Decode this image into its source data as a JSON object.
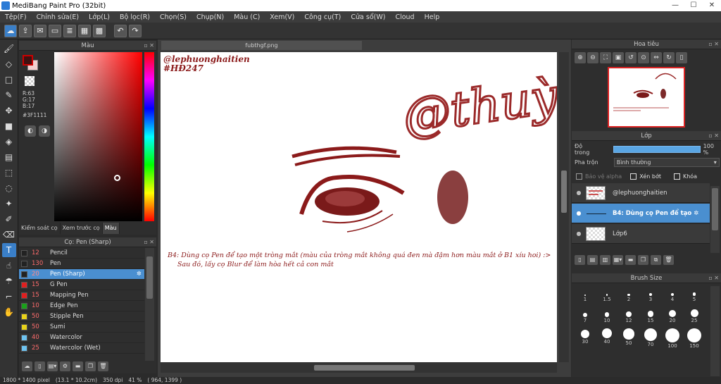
{
  "window": {
    "title": "MediBang Paint Pro (32bit)",
    "min": "—",
    "max": "☐",
    "close": "✕"
  },
  "menu": [
    "Tệp(F)",
    "Chỉnh sửa(E)",
    "Lớp(L)",
    "Bộ lọc(R)",
    "Chọn(S)",
    "Chụp(N)",
    "Màu (C)",
    "Xem(V)",
    "Công cụ(T)",
    "Cửa sổ(W)",
    "Cloud",
    "Help"
  ],
  "color_panel": {
    "title": "Màu",
    "r": "R:63",
    "g": "G:17",
    "b": "B:17",
    "hex": "#3F1111",
    "tabs": [
      "Kiểm soát cọ",
      "Xem trước cọ",
      "Màu"
    ],
    "fg_color": "#3f1111"
  },
  "brush_panel": {
    "title": "Cọ: Pen (Sharp)",
    "items": [
      {
        "size": "12",
        "name": "Pencil",
        "color": "#222222"
      },
      {
        "size": "130",
        "name": "Pen",
        "color": "#222222"
      },
      {
        "size": "20",
        "name": "Pen (Sharp)",
        "color": "#222222",
        "selected": true
      },
      {
        "size": "15",
        "name": "G Pen",
        "color": "#e02020"
      },
      {
        "size": "15",
        "name": "Mapping Pen",
        "color": "#e02020"
      },
      {
        "size": "10",
        "name": "Edge Pen",
        "color": "#1aa01a"
      },
      {
        "size": "50",
        "name": "Stipple Pen",
        "color": "#e8d21a"
      },
      {
        "size": "50",
        "name": "Sumi",
        "color": "#e8d21a"
      },
      {
        "size": "40",
        "name": "Watercolor",
        "color": "#6ec3f0"
      },
      {
        "size": "25",
        "name": "Watercolor (Wet)",
        "color": "#6ec3f0"
      }
    ]
  },
  "document": {
    "tab": "fubthgf.png",
    "credit": "@lephuonghaitien",
    "tag": "#HĐ247",
    "signature": "@thuỳ",
    "note_line1": "B4: Dùng cọ Pen để tạo một tròng mắt (màu của tròng mắt không quá đen mà đậm hơn màu mắt ở B1 xíu hoi) :>",
    "note_line2": "Sau đó, lấy cọ Blur để làm hòa hết cả con mắt"
  },
  "status": {
    "size": "1800 * 1400 pixel",
    "cm": "(13.1 * 10.2cm)",
    "dpi": "350 dpi",
    "zoom": "41 %",
    "coords": "( 964, 1399 )"
  },
  "navigator": {
    "title": "Hoa tiêu"
  },
  "layers_panel": {
    "title": "Lớp",
    "opacity_label": "Độ trong",
    "opacity_value": "100 %",
    "opacity": 1.0,
    "blend_label": "Pha trộn",
    "blend_value": "Bình thường",
    "protect_alpha": "Bảo vệ alpha",
    "clipping": "Xén bớt",
    "lock": "Khóa",
    "layers": [
      {
        "name": "@lephuonghaitien",
        "selected": false
      },
      {
        "name": "B4: Dùng cọ Pen để tạo",
        "selected": true
      },
      {
        "name": "Lớp6",
        "selected": false
      }
    ]
  },
  "brush_size": {
    "title": "Brush Size",
    "sizes": [
      "1",
      "1.5",
      "2",
      "3",
      "4",
      "5",
      "7",
      "10",
      "12",
      "15",
      "20",
      "25",
      "30",
      "40",
      "50",
      "70",
      "100",
      "150"
    ]
  }
}
